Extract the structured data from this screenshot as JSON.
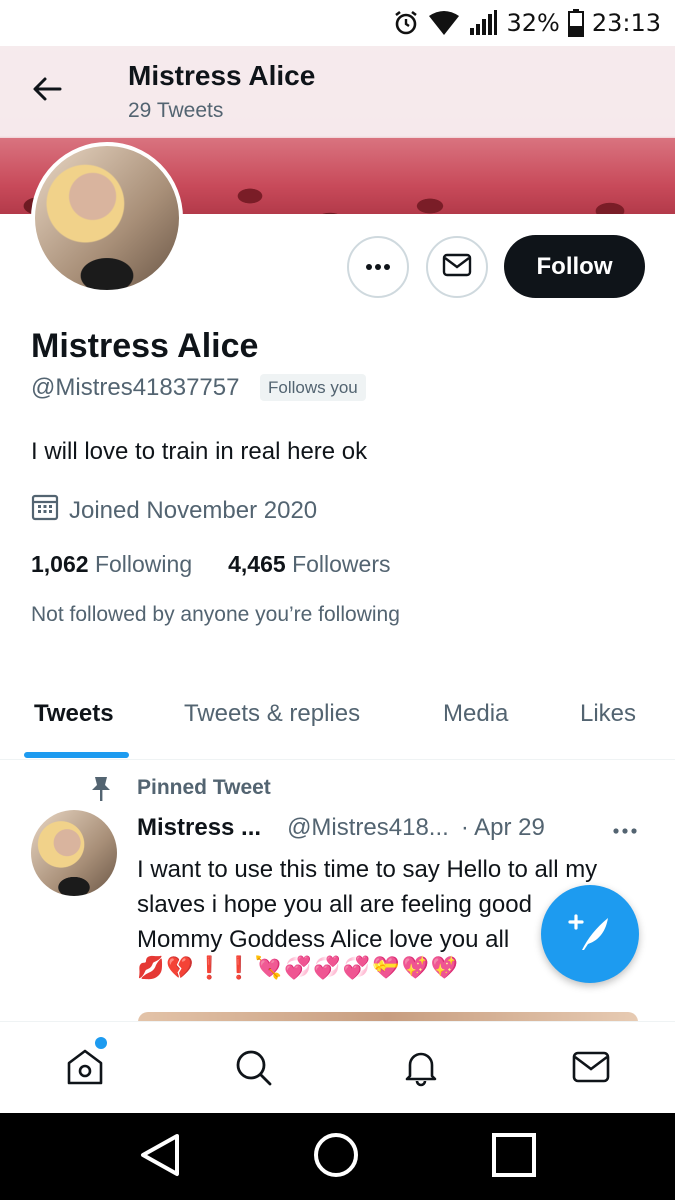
{
  "status_bar": {
    "battery": "32%",
    "time": "23:13"
  },
  "header": {
    "name": "Mistress Alice",
    "tweet_count": "29 Tweets"
  },
  "profile": {
    "display_name": "Mistress Alice",
    "handle": "@Mistres41837757",
    "follows_you": "Follows you",
    "bio": "I will love to train in real here ok",
    "joined": "Joined November 2020",
    "following_count": "1,062",
    "following_label": "Following",
    "followers_count": "4,465",
    "followers_label": "Followers",
    "not_followed": "Not followed by anyone you’re following"
  },
  "actions": {
    "follow_label": "Follow"
  },
  "tabs": [
    {
      "label": "Tweets",
      "active": true
    },
    {
      "label": "Tweets & replies",
      "active": false
    },
    {
      "label": "Media",
      "active": false
    },
    {
      "label": "Likes",
      "active": false
    }
  ],
  "pinned_tweet": {
    "pinned_label": "Pinned Tweet",
    "author": "Mistress ...",
    "handle": "@Mistres418...",
    "date": "· Apr 29",
    "lines": [
      "I want to use this time to say Hello to all my",
      "slaves i hope you all are feeling good",
      "Mommy Goddess Alice love you all"
    ],
    "emoji": "💋💔❗❗💘💞💞💞💝💖💖"
  },
  "colors": {
    "accent": "#1d9bf0",
    "text": "#0f1419",
    "muted": "#536471",
    "follow_bg": "#0f1419"
  },
  "icons": [
    "back-arrow-icon",
    "more-icon",
    "mail-icon",
    "calendar-icon",
    "pin-icon",
    "compose-icon",
    "home-icon",
    "search-icon",
    "bell-icon",
    "mail-icon",
    "android-back-icon",
    "android-home-icon",
    "android-recents-icon"
  ]
}
